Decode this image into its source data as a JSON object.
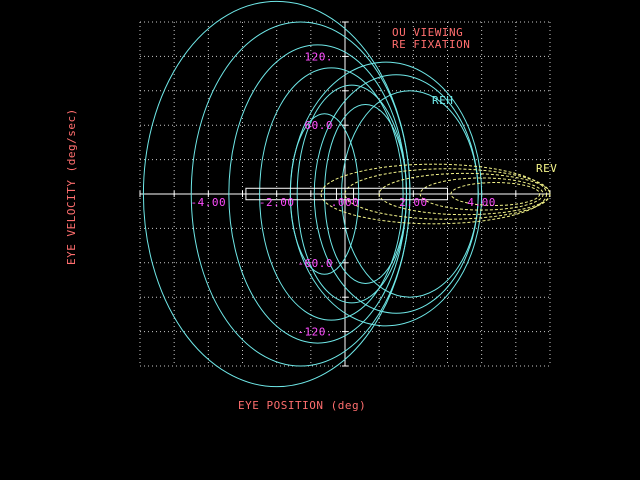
{
  "chart_data": {
    "type": "line",
    "title_lines": [
      "OU VIEWING",
      "RE FIXATION"
    ],
    "xlabel": "EYE POSITION (deg)",
    "ylabel": "EYE VELOCITY (deg/sec)",
    "xlim": [
      -6.0,
      6.0
    ],
    "ylim": [
      -150,
      150
    ],
    "grid": true,
    "x_ticks": [
      "-4.00",
      "-2.00",
      ".000",
      "2.00",
      "4.00"
    ],
    "y_ticks": [
      "120.",
      "60.0",
      "-60.0",
      "-120."
    ],
    "series": [
      {
        "name": "REH",
        "color": "#6fe8e8",
        "style": "solid",
        "loops": [
          {
            "x0": -2.0,
            "rx": 3.9,
            "vmax": 168
          },
          {
            "x0": -1.3,
            "rx": 3.2,
            "vmax": 150
          },
          {
            "x0": -0.8,
            "rx": 2.6,
            "vmax": 130
          },
          {
            "x0": -0.4,
            "rx": 2.1,
            "vmax": 110
          },
          {
            "x0": 0.2,
            "rx": 1.6,
            "vmax": 95
          },
          {
            "x0": 0.6,
            "rx": 1.2,
            "vmax": 78
          },
          {
            "x0": -0.6,
            "rx": 1.0,
            "vmax": 70
          },
          {
            "x0": 1.2,
            "rx": 2.8,
            "vmax": 115
          },
          {
            "x0": 1.5,
            "rx": 2.4,
            "vmax": 104
          },
          {
            "x0": 1.9,
            "rx": 2.0,
            "vmax": 90
          }
        ]
      },
      {
        "name": "REV",
        "color": "#f5f58a",
        "style": "dashed",
        "loops": [
          {
            "x0": 3.0,
            "rx": 3.0,
            "vmax": 22
          },
          {
            "x0": 3.5,
            "rx": 2.5,
            "vmax": 18
          },
          {
            "x0": 4.0,
            "rx": 1.8,
            "vmax": 14
          },
          {
            "x0": 2.6,
            "rx": 3.3,
            "vmax": 26
          },
          {
            "x0": 4.4,
            "rx": 1.3,
            "vmax": 10
          }
        ]
      }
    ],
    "fixation_window": {
      "x": [
        -2.9,
        3.0
      ],
      "v": [
        -5,
        5
      ]
    }
  },
  "colors": {
    "background": "#000000",
    "grid": "#c8c8c8",
    "axis": "#ffffff",
    "label_red": "#ff6e6e",
    "tick_magenta": "#ff4cff",
    "reh": "#6fe8e8",
    "rev": "#f5f58a"
  }
}
